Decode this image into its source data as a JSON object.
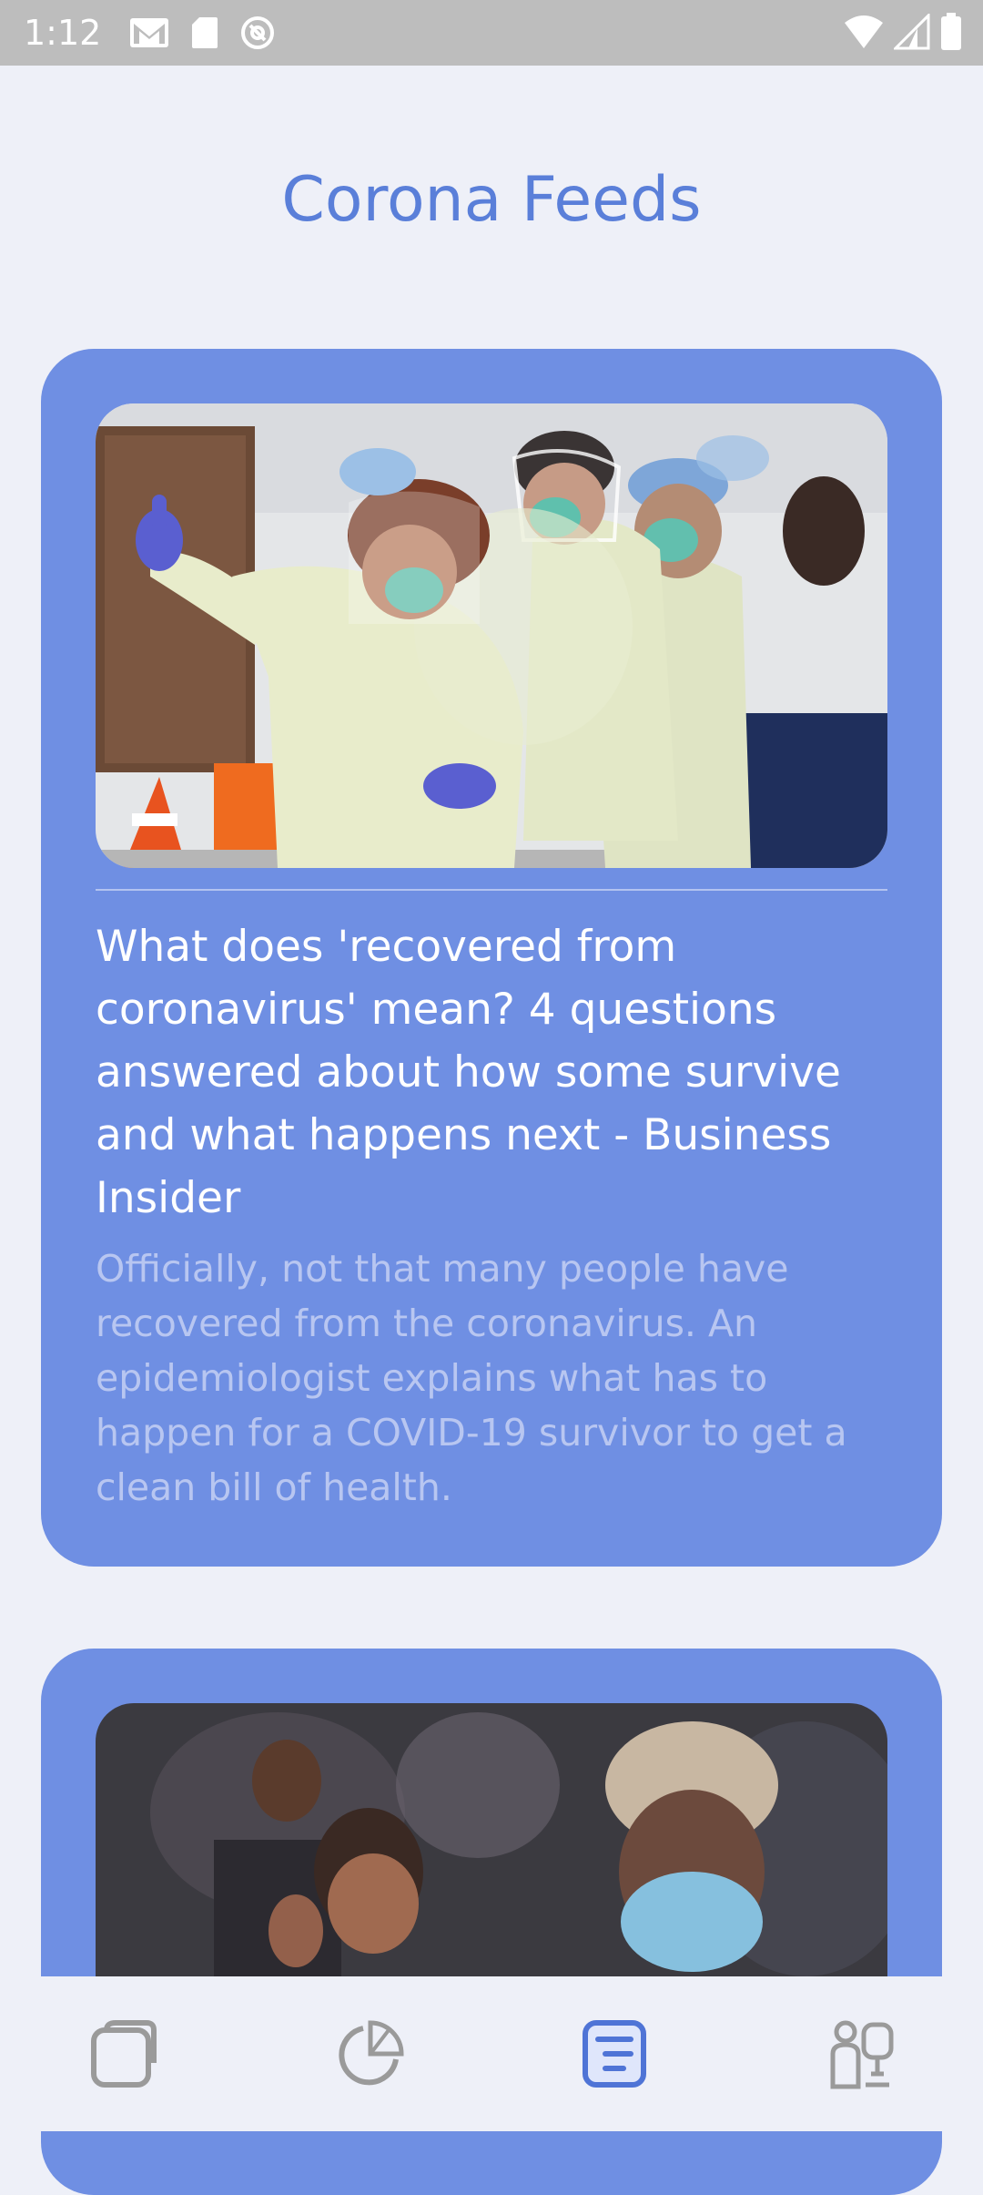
{
  "status_bar": {
    "time": "1:12",
    "left_icons": [
      "gmail-icon",
      "sd-card-icon",
      "sync-icon"
    ],
    "right_icons": [
      "wifi-icon",
      "cell-signal-icon",
      "battery-icon"
    ]
  },
  "header": {
    "title": "Corona Feeds"
  },
  "feeds": [
    {
      "image": "healthcare-workers-photo",
      "title": "What does 'recovered from coronavirus' mean? 4 questions answered about how some survive and what happens next - Business Insider",
      "description": "Officially, not that many people have recovered from the coronavirus. An epidemiologist explains what has to happen for a COVID-19 survivor to get a clean bill of health."
    },
    {
      "image": "masked-people-crowd-photo"
    }
  ],
  "bottom_nav": {
    "items": [
      {
        "icon": "cards-icon",
        "active": false
      },
      {
        "icon": "pie-chart-icon",
        "active": false
      },
      {
        "icon": "feed-list-icon",
        "active": true
      },
      {
        "icon": "doctor-icon",
        "active": false
      }
    ]
  },
  "colors": {
    "accent": "#5a7fd9",
    "card": "#6f8fe3",
    "background": "#eef0f8",
    "inactive_icon": "#9a9a9a",
    "active_icon": "#4f74d6"
  }
}
